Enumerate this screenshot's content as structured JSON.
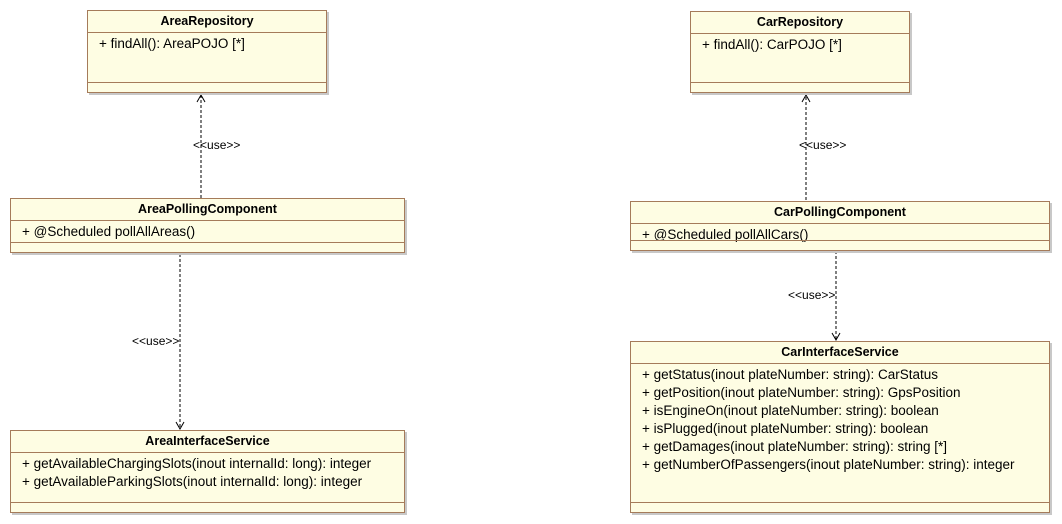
{
  "classes": {
    "area_repository": {
      "name": "AreaRepository",
      "operations": [
        "+ findAll(): AreaPOJO [*]"
      ]
    },
    "area_polling": {
      "name": "AreaPollingComponent",
      "operations": [
        "+ @Scheduled pollAllAreas()"
      ]
    },
    "area_interface": {
      "name": "AreaInterfaceService",
      "operations": [
        "+ getAvailableChargingSlots(inout internalId: long): integer",
        "+ getAvailableParkingSlots(inout internalId: long): integer"
      ]
    },
    "car_repository": {
      "name": "CarRepository",
      "operations": [
        "+ findAll(): CarPOJO [*]"
      ]
    },
    "car_polling": {
      "name": "CarPollingComponent",
      "operations": [
        "+ @Scheduled pollAllCars()"
      ]
    },
    "car_interface": {
      "name": "CarInterfaceService",
      "operations": [
        "+ getStatus(inout plateNumber: string): CarStatus",
        "+ getPosition(inout plateNumber: string): GpsPosition",
        "+ isEngineOn(inout plateNumber: string): boolean",
        "+ isPlugged(inout plateNumber: string): boolean",
        "+ getDamages(inout plateNumber: string): string [*]",
        "+ getNumberOfPassengers(inout plateNumber: string): integer"
      ]
    }
  },
  "dependencies": {
    "area_poll_to_repo": {
      "stereotype": "<<use>>"
    },
    "area_poll_to_interface": {
      "stereotype": "<<use>>"
    },
    "car_poll_to_repo": {
      "stereotype": "<<use>>"
    },
    "car_poll_to_interface": {
      "stereotype": "<<use>>"
    }
  },
  "colors": {
    "fill": "#fefde3",
    "border": "#a57b5a",
    "line": "#000000"
  }
}
